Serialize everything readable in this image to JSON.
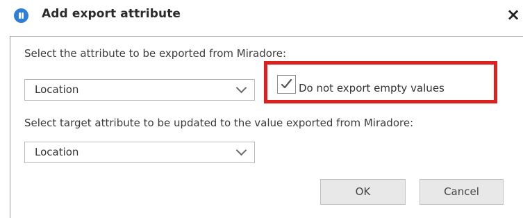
{
  "dialog": {
    "title": "Add export attribute",
    "close_label": "×"
  },
  "form": {
    "source_label": "Select the attribute to be exported from Miradore:",
    "source_value": "Location",
    "empty_values_checkbox": {
      "label": "Do not export empty values",
      "checked": true
    },
    "target_label": "Select target attribute to be updated to the value exported from Miradore:",
    "target_value": "Location"
  },
  "buttons": {
    "ok_label": "OK",
    "cancel_label": "Cancel"
  },
  "colors": {
    "app_icon": "#2f7fd6",
    "highlight": "#dc1f1f",
    "button_bg": "#e8e8e8"
  },
  "icons": {
    "app": "miradore-logo-icon",
    "close": "close-icon",
    "dropdown": "chevron-down-icon",
    "check": "checkmark-icon"
  }
}
